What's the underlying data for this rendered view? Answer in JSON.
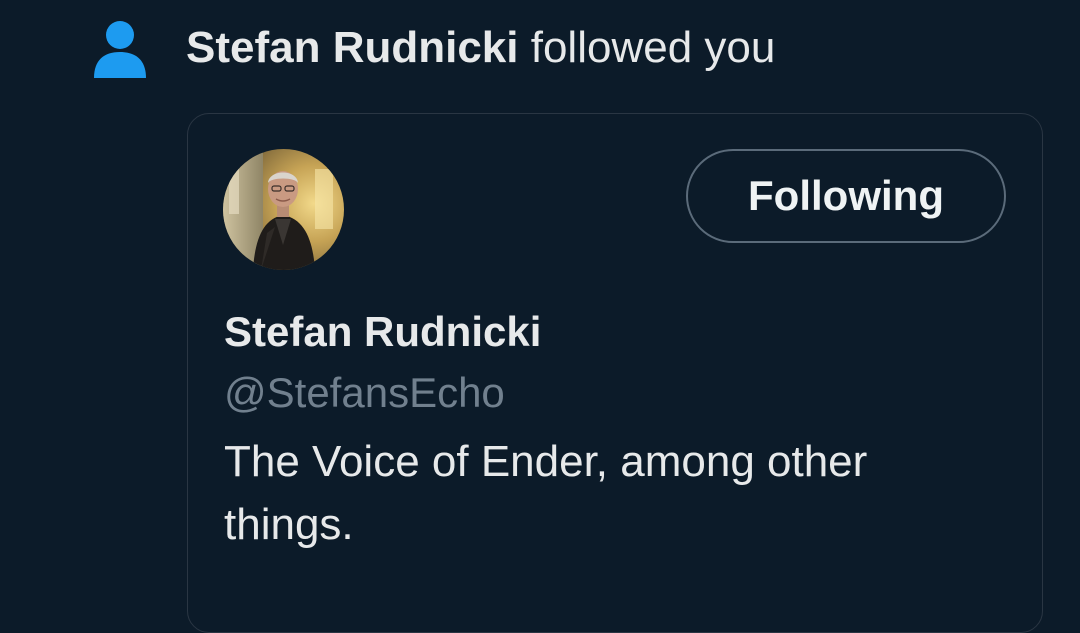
{
  "notification": {
    "actor_name": "Stefan Rudnicki",
    "action_text": "followed you",
    "icon": "person-icon",
    "icon_color": "#1d9bf0"
  },
  "user_card": {
    "avatar": "profile-photo-avatar",
    "display_name": "Stefan Rudnicki",
    "handle": "@StefansEcho",
    "bio": "The Voice of Ender, among other things.",
    "follow_button_label": "Following"
  },
  "colors": {
    "background": "#0c1b29",
    "primary_text": "#e7e9ea",
    "secondary_text": "#71808e",
    "card_border": "#2a3643",
    "button_border": "#5b6b7a",
    "accent": "#1d9bf0"
  }
}
